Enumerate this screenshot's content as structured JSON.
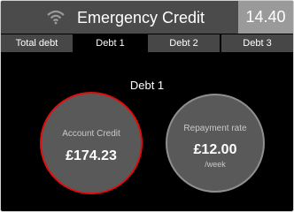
{
  "header": {
    "title": "Emergency Credit",
    "time": "14.40",
    "icon": "wifi-icon"
  },
  "tabs": [
    {
      "label": "Total debt",
      "active": false
    },
    {
      "label": "Debt 1",
      "active": true
    },
    {
      "label": "Debt 2",
      "active": false
    },
    {
      "label": "Debt 3",
      "active": false
    }
  ],
  "section": {
    "title": "Debt 1"
  },
  "account_credit": {
    "label": "Account Credit",
    "value": "£174.23"
  },
  "repayment": {
    "label": "Repayment rate",
    "value": "£12.00",
    "unit": "/week"
  },
  "colors": {
    "background": "#000000",
    "header": "#4b4b4b",
    "clock": "#9a9a9a",
    "credit_ring": "#e00d0d",
    "repay_ring": "#8f8f8f"
  }
}
